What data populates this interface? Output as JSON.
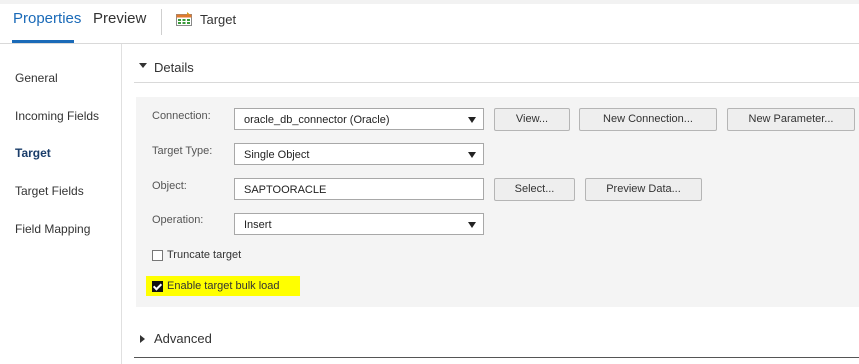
{
  "tabs": {
    "properties": "Properties",
    "preview": "Preview"
  },
  "header": {
    "title": "Target"
  },
  "nav": {
    "items": [
      "General",
      "Incoming Fields",
      "Target",
      "Target Fields",
      "Field Mapping"
    ],
    "active": "Target"
  },
  "details": {
    "section_title": "Details",
    "connection": {
      "label": "Connection:",
      "value": "oracle_db_connector (Oracle)",
      "buttons": {
        "view": "View...",
        "new_connection": "New Connection...",
        "new_parameter": "New Parameter..."
      }
    },
    "target_type": {
      "label": "Target Type:",
      "value": "Single Object"
    },
    "object": {
      "label": "Object:",
      "value": "SAPTOORACLE",
      "buttons": {
        "select": "Select...",
        "preview_data": "Preview Data..."
      }
    },
    "operation": {
      "label": "Operation:",
      "value": "Insert"
    },
    "truncate_target": {
      "label": "Truncate target",
      "checked": false
    },
    "enable_bulk_load": {
      "label": "Enable target bulk load",
      "checked": true
    }
  },
  "advanced": {
    "section_title": "Advanced"
  },
  "colors": {
    "accent": "#1a6ab8",
    "highlight": "#ffff00",
    "form_bg": "#f4f4f4"
  }
}
